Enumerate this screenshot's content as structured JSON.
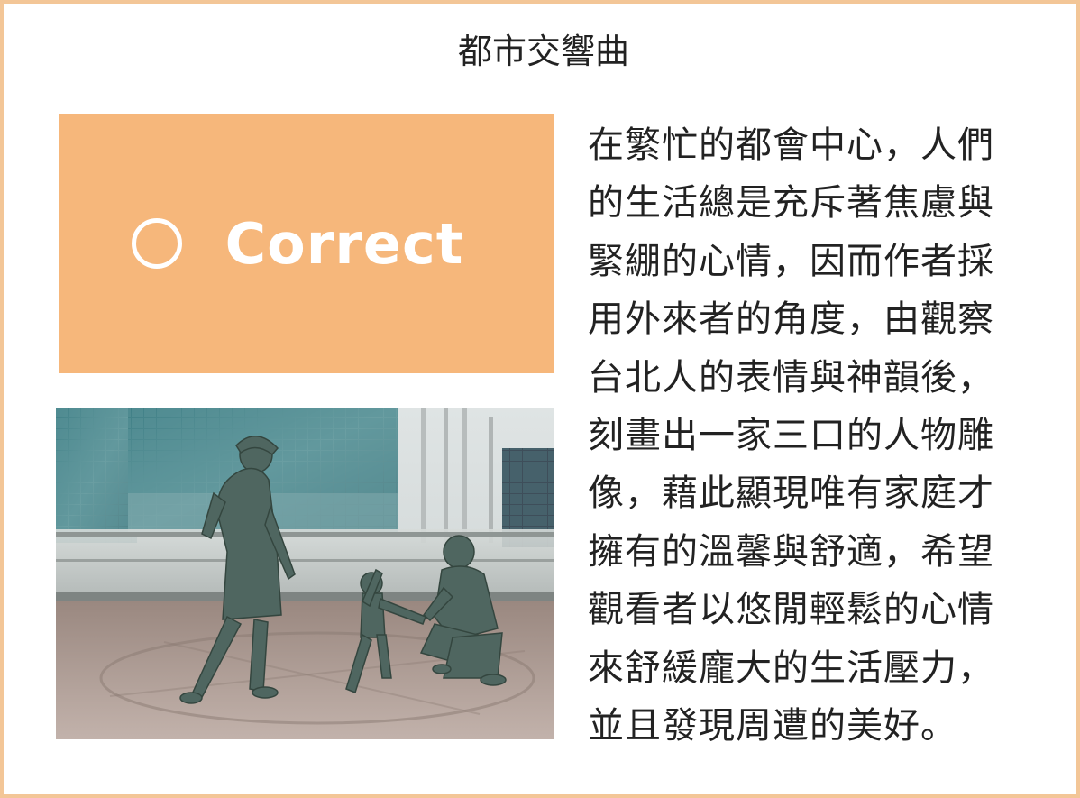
{
  "title": "都市交響曲",
  "answer": {
    "label": "Correct",
    "icon": "circle-icon",
    "background_color": "#f6b77b"
  },
  "photo": {
    "icon": "sculpture-photo"
  },
  "body_lines": [
    "在繁忙的都會中心，人們",
    "的生活總是充斥著焦慮與",
    "緊綳的心情，因而作者採",
    "用外來者的角度，由觀察",
    "台北人的表情與神韻後，",
    "刻畫出一家三口的人物雕",
    "像，藉此顯現唯有家庭才",
    "擁有的溫馨與舒適，希望",
    "觀看者以悠閒輕鬆的心情",
    "來舒緩龐大的生活壓力，",
    "並且發現周遭的美好。"
  ],
  "border_color": "#f3c697"
}
